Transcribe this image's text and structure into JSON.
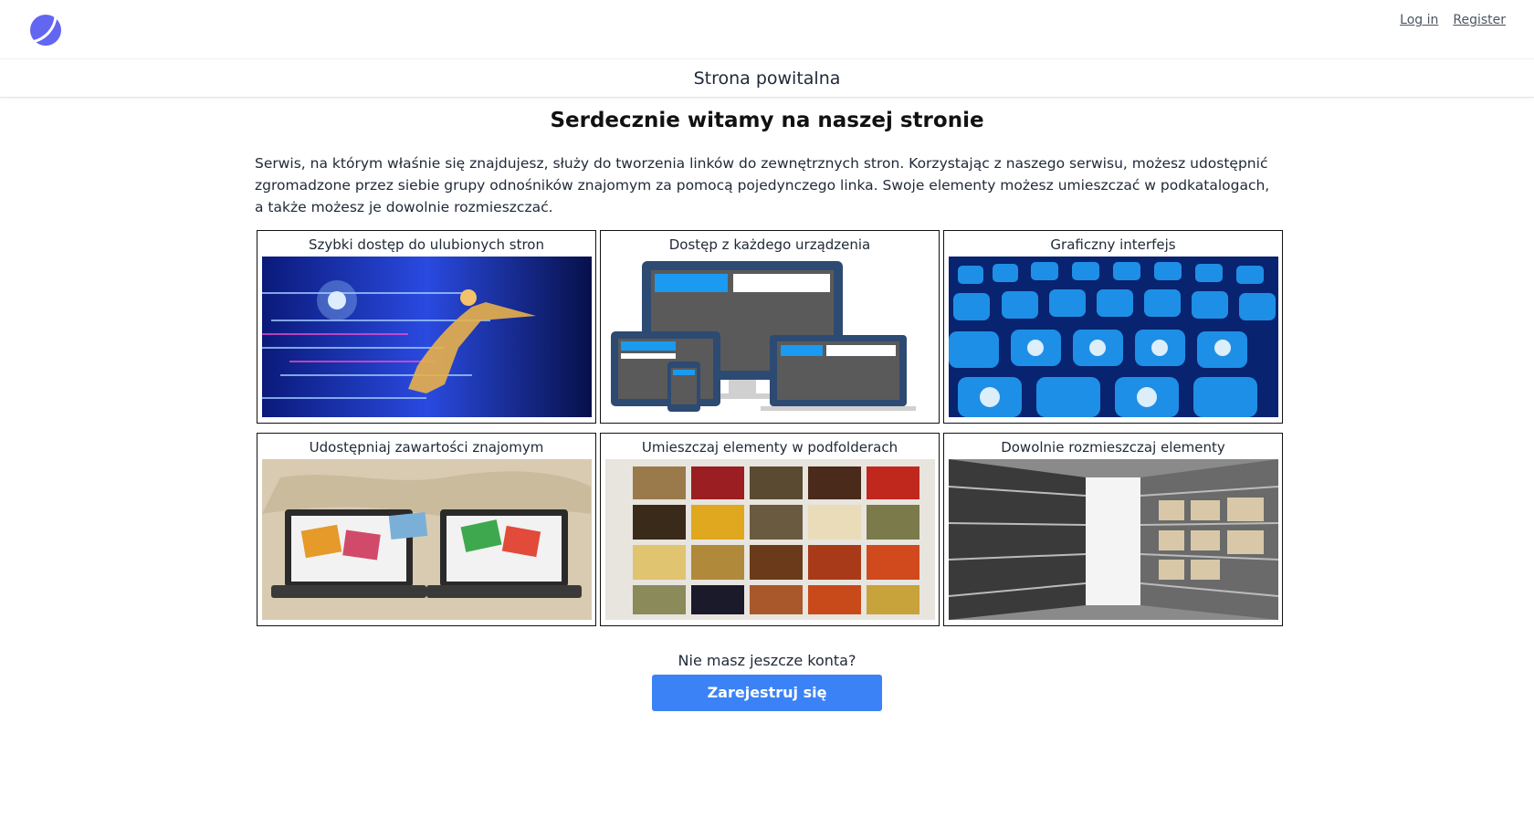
{
  "header": {
    "login_label": "Log in",
    "register_label": "Register",
    "brand_color": "#6366f1"
  },
  "subheader": {
    "title": "Strona powitalna"
  },
  "main": {
    "heading": "Serdecznie witamy na naszej stronie",
    "intro": "Serwis, na którym właśnie się znajdujesz, służy do tworzenia linków do zewnętrznych stron. Korzystając z naszego serwisu, możesz udostępnić zgromadzone przez siebie grupy odnośników znajomym za pomocą pojedynczego linka. Swoje elementy możesz umieszczać w podkatalogach, a także możesz je dowolnie rozmieszczać.",
    "features": [
      {
        "title": "Szybki dostęp do ulubionych stron",
        "image": "speed-hero-image"
      },
      {
        "title": "Dostęp z każdego urządzenia",
        "image": "devices-image"
      },
      {
        "title": "Graficzny interfejs",
        "image": "app-icons-image"
      },
      {
        "title": "Udostępniaj zawartości znajomym",
        "image": "laptops-sharing-image"
      },
      {
        "title": "Umieszczaj elementy w podfolderach",
        "image": "spice-box-image"
      },
      {
        "title": "Dowolnie rozmieszczaj elementy",
        "image": "archive-shelves-image"
      }
    ],
    "cta_text": "Nie masz jeszcze konta?",
    "cta_button": "Zarejestruj się",
    "accent_color": "#3b82f6"
  }
}
